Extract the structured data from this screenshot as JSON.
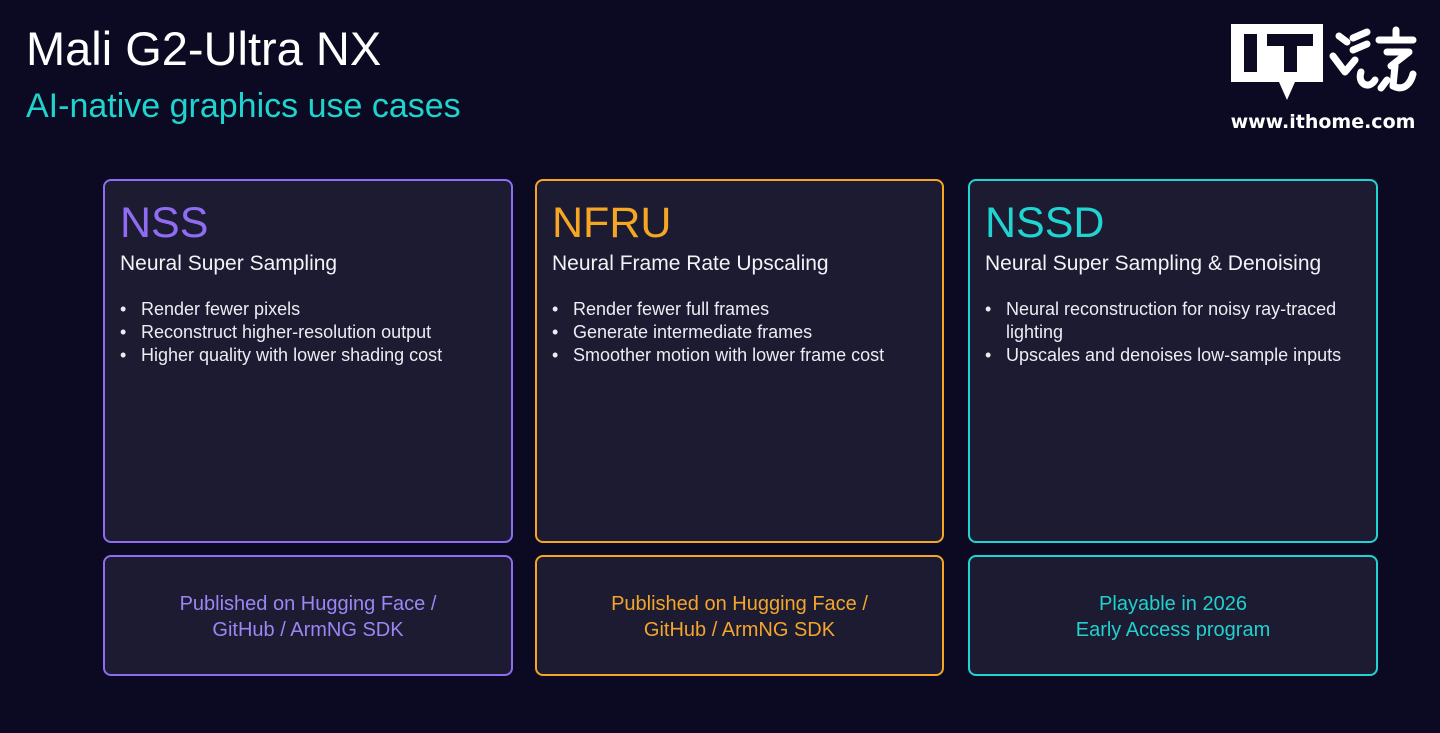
{
  "header": {
    "title": "Mali G2-Ultra NX",
    "subtitle": "AI-native graphics use cases"
  },
  "cards": [
    {
      "acronym": "NSS",
      "name": "Neural Super Sampling",
      "accent": "#8f6cf2",
      "bullets": [
        "Render fewer pixels",
        "Reconstruct higher-resolution output",
        "Higher quality with lower shading cost"
      ]
    },
    {
      "acronym": "NFRU",
      "name": "Neural Frame Rate Upscaling",
      "accent": "#f5a623",
      "bullets": [
        "Render fewer full frames",
        "Generate intermediate frames",
        "Smoother motion with lower frame cost"
      ]
    },
    {
      "acronym": "NSSD",
      "name": "Neural Super Sampling & Denoising",
      "accent": "#20d4d2",
      "bullets": [
        "Neural reconstruction for noisy ray-traced lighting",
        "Upscales and denoises low-sample inputs"
      ]
    }
  ],
  "notes": [
    {
      "lines": [
        "Published on Hugging Face /",
        "GitHub / ArmNG SDK"
      ],
      "color": "#9b86f4"
    },
    {
      "lines": [
        "Published on Hugging Face /",
        "GitHub / ArmNG SDK"
      ],
      "color": "#f3a52c"
    },
    {
      "lines": [
        "Playable in 2026",
        "Early Access program"
      ],
      "color": "#21d0cf"
    }
  ],
  "bullet_symbol": "•",
  "watermark": {
    "logo_text": "IT之家",
    "url": "www.ithome.com"
  }
}
